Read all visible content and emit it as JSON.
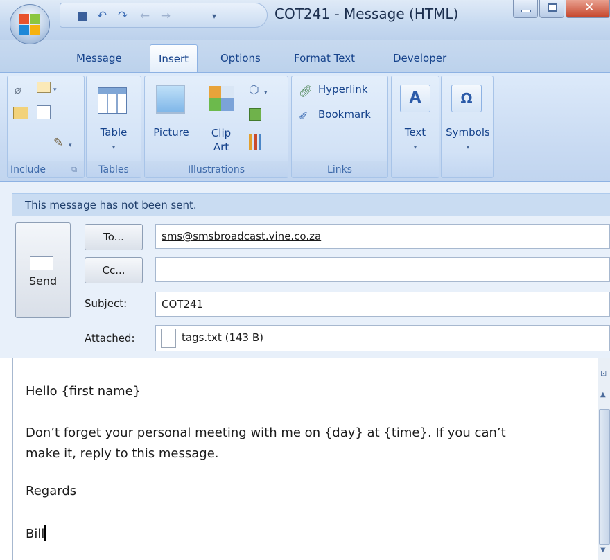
{
  "window": {
    "title": "COT241 - Message (HTML)"
  },
  "tabs": [
    {
      "label": "Message"
    },
    {
      "label": "Insert"
    },
    {
      "label": "Options"
    },
    {
      "label": "Format Text"
    },
    {
      "label": "Developer"
    }
  ],
  "ribbon": {
    "groups": {
      "include": "Include",
      "tables": "Tables",
      "illustrations": "Illustrations",
      "links": "Links"
    },
    "buttons": {
      "table": "Table",
      "picture": "Picture",
      "clip_art_line1": "Clip",
      "clip_art_line2": "Art",
      "hyperlink": "Hyperlink",
      "bookmark": "Bookmark",
      "text": "Text",
      "symbols": "Symbols"
    }
  },
  "message": {
    "info": "This message has not been sent.",
    "send_label": "Send",
    "to_button": "To...",
    "cc_button": "Cc...",
    "subject_label": "Subject:",
    "attached_label": "Attached:",
    "to_value": "sms@smsbroadcast.vine.co.za",
    "cc_value": "",
    "subject_value": "COT241",
    "attachment": "tags.txt (143 B)"
  },
  "body": {
    "line1": "Hello {first name}",
    "line2": "Don’t forget your personal meeting with me on {day} at {time}. If you can’t",
    "line3": "make it, reply to this message.",
    "line4": "Regards",
    "line5": "Bill"
  },
  "colors": {
    "ribbon_text": "#15428b",
    "tab_bar": "#bcd2ec"
  }
}
